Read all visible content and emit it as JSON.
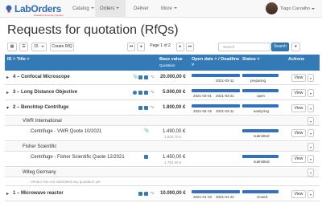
{
  "navbar": {
    "logo_text": "LabOrders",
    "logo_sub": "Research Inventory System",
    "items": [
      {
        "label": "Catalog",
        "has_caret": true
      },
      {
        "label": "Orders",
        "has_caret": true,
        "active": true
      },
      {
        "label": "Deliver",
        "has_caret": false
      },
      {
        "label": "More",
        "has_caret": true
      }
    ],
    "user_name": "Tiago Carvalho"
  },
  "page_title": "Requests for quotation (RfQs)",
  "toolbar": {
    "page_size": "15",
    "create_label": "Create RfQ",
    "pager_label": "Page 1 of 2",
    "search_placeholder": "Search",
    "search_button": "Search"
  },
  "table": {
    "headers": {
      "id_title": "ID ˄ Title ˅",
      "base_value": "Base value",
      "base_value_sub": "Quotation",
      "open_date": "Open date ˄ / Deadline ˅",
      "status": "Status ˅",
      "actions": "Actions"
    },
    "rows": [
      {
        "id_title": "4 – Confocal Microscope",
        "value": "20.000,00 €",
        "start": "",
        "end": "2021-03-11",
        "status": "preparing",
        "action": "View"
      },
      {
        "id_title": "3 – Long Distance Objective",
        "value": "5.000,00 €",
        "start": "2021-03-01",
        "end": "2021-03-21",
        "status": "open",
        "action": "View"
      },
      {
        "id_title": "2 – Benchtop Centrifuge",
        "value": "1.800,00 €",
        "start": "2021-02-15",
        "end": "2021-03-11",
        "status": "analyzing",
        "action": "View"
      }
    ],
    "vendors": [
      {
        "name": "VWR International",
        "quote": "Centrifuge - VWR Quote 10/2021",
        "value": "1.490,00 €",
        "value_sub": "1.832,70 €",
        "status": "submitted",
        "action": "View"
      },
      {
        "name": "Fisher Scientific",
        "quote": "Centrifuge - Fisher Scientific Quote 12/2021",
        "value": "1.450,00 €",
        "value_sub": "1.783,50 €",
        "status": "submitted",
        "action": "View"
      },
      {
        "name": "Witeg Germany",
        "note": "Vendor has not submitted any quotation yet"
      }
    ],
    "last_row": {
      "id_title": "1 – Microwave reactor",
      "value": "10.000,00 €",
      "start": "2021-01-10",
      "end": "2021-01-31",
      "status": "closed",
      "action": "View"
    }
  }
}
